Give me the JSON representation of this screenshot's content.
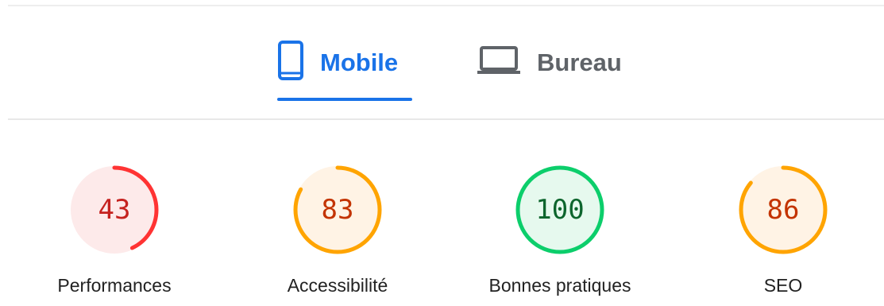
{
  "tabs": [
    {
      "label": "Mobile",
      "icon": "smartphone-icon",
      "active": true
    },
    {
      "label": "Bureau",
      "icon": "laptop-icon",
      "active": false
    }
  ],
  "colors": {
    "accent": "#1a73e8",
    "fail": "#ff3333",
    "fail_text": "#c5221f",
    "fail_bg": "#fdeaea",
    "average": "#ffa400",
    "average_text": "#c33300",
    "average_bg": "#fff3e5",
    "pass": "#0cce6b",
    "pass_text": "#0d652d",
    "pass_bg": "#e6f9ee"
  },
  "scores": [
    {
      "label": "Performances",
      "value": "43",
      "score": 43,
      "rating": "fail"
    },
    {
      "label": "Accessibilité",
      "value": "83",
      "score": 83,
      "rating": "average"
    },
    {
      "label": "Bonnes pratiques",
      "value": "100",
      "score": 100,
      "rating": "pass"
    },
    {
      "label": "SEO",
      "value": "86",
      "score": 86,
      "rating": "average"
    }
  ]
}
